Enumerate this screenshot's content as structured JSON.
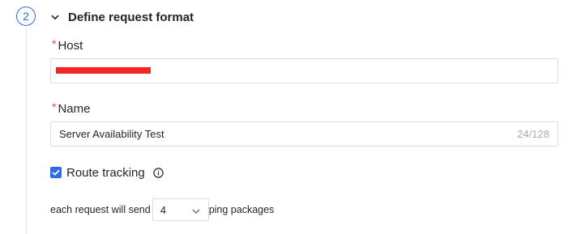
{
  "step": {
    "number": "2",
    "title": "Define request format"
  },
  "host": {
    "label": "Host",
    "required_mark": "*",
    "value_redacted": true
  },
  "name": {
    "label": "Name",
    "required_mark": "*",
    "value": "Server Availability Test",
    "counter": "24/128"
  },
  "route_tracking": {
    "label": "Route tracking",
    "checked": true,
    "icon": "info-icon"
  },
  "ping": {
    "prefix": "each request will send",
    "selected_value": "4",
    "suffix": "ping packages"
  },
  "colors": {
    "accent": "#2e6be6",
    "required": "#f54a45",
    "redaction": "#f42525"
  }
}
